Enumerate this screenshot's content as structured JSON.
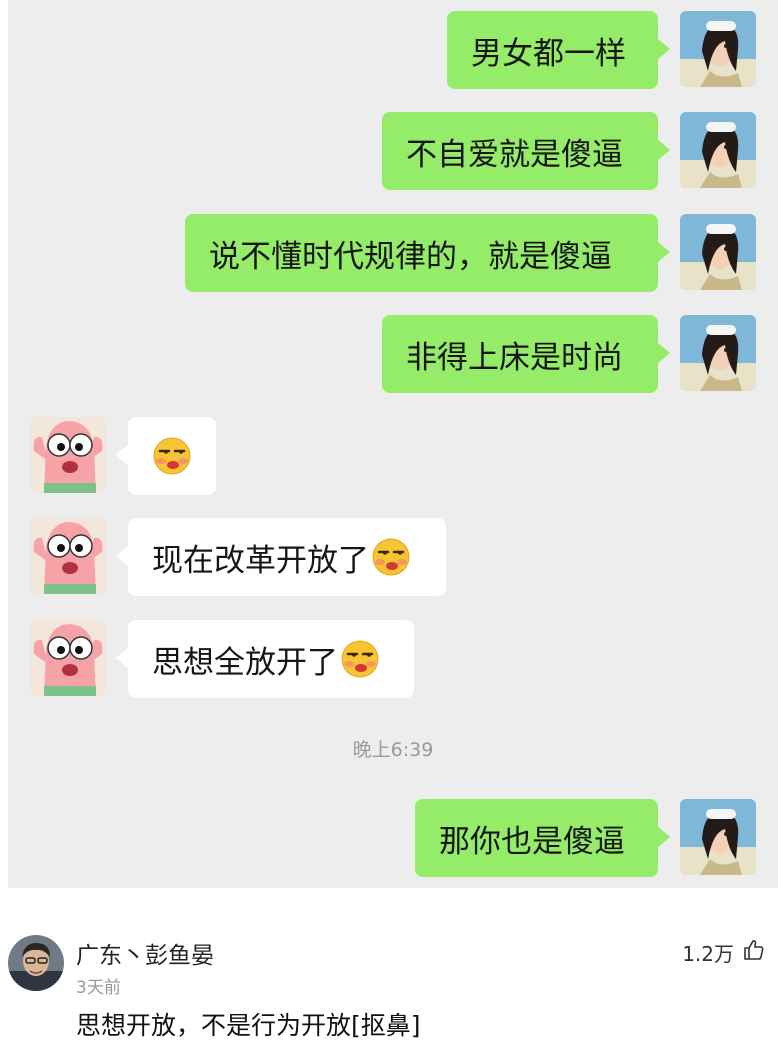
{
  "chat": {
    "messages": [
      {
        "side": "out",
        "text": "男女都一样",
        "emoji": false
      },
      {
        "side": "out",
        "text": "不自爱就是傻逼",
        "emoji": false
      },
      {
        "side": "out",
        "text": "说不懂时代规律的，就是傻逼",
        "emoji": false
      },
      {
        "side": "out",
        "text": "非得上床是时尚",
        "emoji": false
      },
      {
        "side": "in",
        "text": "",
        "emoji": true
      },
      {
        "side": "in",
        "text": "现在改革开放了",
        "emoji": true
      },
      {
        "side": "in",
        "text": "思想全放开了",
        "emoji": true
      },
      {
        "side": "out",
        "text": "那你也是傻逼",
        "emoji": false
      }
    ],
    "timestamp": "晚上6:39"
  },
  "comment": {
    "author": "广东丶彭鱼晏",
    "time": "3天前",
    "text": "思想开放，不是行为开放[抠鼻]",
    "likes": "1.2万"
  },
  "icons": {
    "thumbs_up": "thumbs-up-icon",
    "emoji": "shy-smirk-emoji"
  }
}
